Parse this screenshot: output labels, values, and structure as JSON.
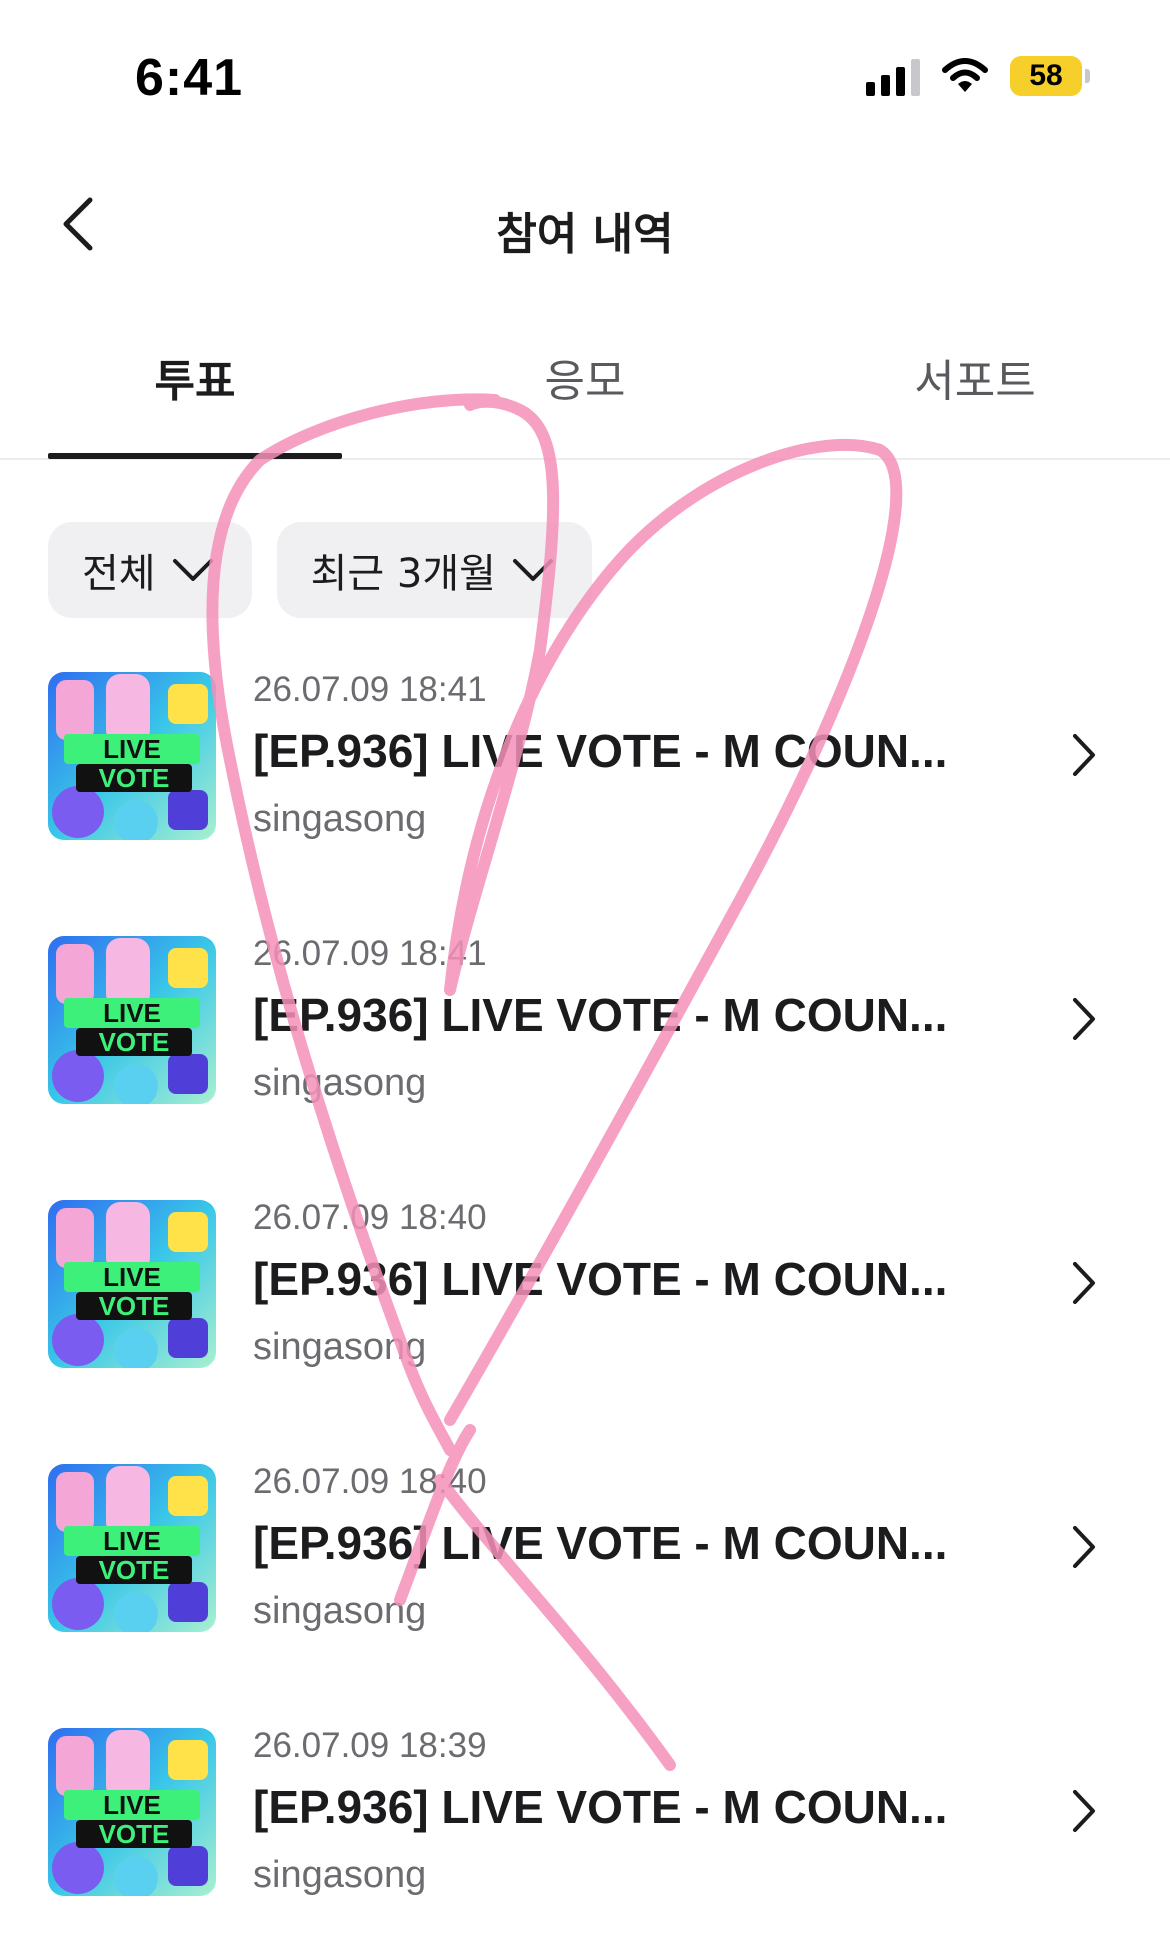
{
  "status_bar": {
    "time": "6:41",
    "battery": "58",
    "icons": [
      "signal-icon",
      "wifi-icon",
      "battery-icon"
    ]
  },
  "header": {
    "title": "참여 내역",
    "back_icon": "chevron-left-icon"
  },
  "tabs": [
    {
      "label": "투표",
      "active": true
    },
    {
      "label": "응모",
      "active": false
    },
    {
      "label": "서포트",
      "active": false
    }
  ],
  "filters": [
    {
      "label": "전체",
      "icon": "chevron-down-icon"
    },
    {
      "label": "최근 3개월",
      "icon": "chevron-down-icon"
    }
  ],
  "items": [
    {
      "date": "26.07.09 18:41",
      "title": "[EP.936] LIVE VOTE - M COUN...",
      "subtitle": "singasong",
      "thumb_top": "LIVE",
      "thumb_bottom": "VOTE"
    },
    {
      "date": "26.07.09 18:41",
      "title": "[EP.936] LIVE VOTE - M COUN...",
      "subtitle": "singasong",
      "thumb_top": "LIVE",
      "thumb_bottom": "VOTE"
    },
    {
      "date": "26.07.09 18:40",
      "title": "[EP.936] LIVE VOTE - M COUN...",
      "subtitle": "singasong",
      "thumb_top": "LIVE",
      "thumb_bottom": "VOTE"
    },
    {
      "date": "26.07.09 18:40",
      "title": "[EP.936] LIVE VOTE - M COUN...",
      "subtitle": "singasong",
      "thumb_top": "LIVE",
      "thumb_bottom": "VOTE"
    },
    {
      "date": "26.07.09 18:39",
      "title": "[EP.936] LIVE VOTE - M COUN...",
      "subtitle": "singasong",
      "thumb_top": "LIVE",
      "thumb_bottom": "VOTE"
    }
  ],
  "colors": {
    "accent_underline": "#1c1c1e",
    "chip_background": "#f0f0f2",
    "battery": "#f6cf2a",
    "overlay_stroke": "#f48fb8"
  }
}
